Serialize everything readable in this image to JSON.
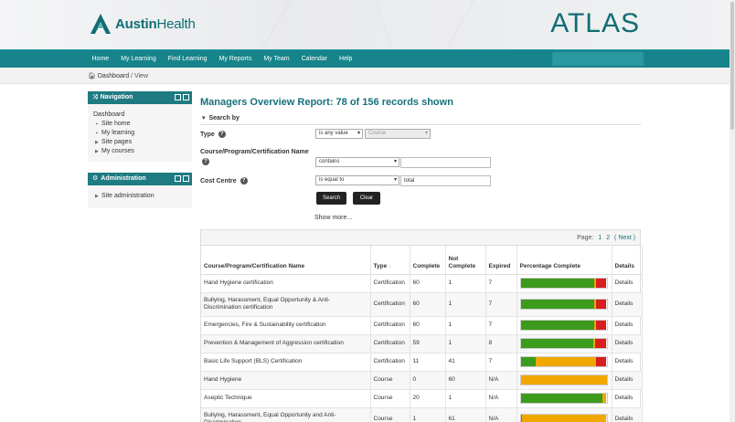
{
  "brand": {
    "logo_bold": "Austin",
    "logo_light": "Health",
    "app_name": "ATLAS"
  },
  "nav": [
    "Home",
    "My Learning",
    "Find Learning",
    "My Reports",
    "My Team",
    "Calendar",
    "Help"
  ],
  "breadcrumb": {
    "home": "Dashboard",
    "sep": "/",
    "current": "View"
  },
  "nav_block": {
    "title": "Navigation",
    "root": "Dashboard",
    "items": [
      "Site home",
      "My learning",
      "Site pages",
      "My courses"
    ]
  },
  "admin_block": {
    "title": "Administration",
    "items": [
      "Site administration"
    ]
  },
  "report": {
    "title": "Managers Overview Report: 78 of 156 records shown",
    "search_by": "Search by",
    "type_label": "Type",
    "type_op": "is any value",
    "type_value": "Course",
    "name_label": "Course/Program/Certification Name",
    "name_op": "contains",
    "name_value": "",
    "cc_label": "Cost Centre",
    "cc_op": "is equal to",
    "cc_value": "total",
    "search_btn": "Search",
    "clear_btn": "Clear",
    "show_more": "Show more..."
  },
  "pager": {
    "label": "Page:",
    "pages": [
      "1",
      "2"
    ],
    "next": "( Next )"
  },
  "table": {
    "headers": [
      "Course/Program/Certification Name",
      "Type",
      "Complete",
      "Not Complete",
      "Expired",
      "Percentage Complete",
      "Details"
    ],
    "rows": [
      {
        "name": "Hand Hygiene certification",
        "type": "Certification",
        "complete": "60",
        "not_complete": "1",
        "expired": "7",
        "pct": {
          "complete": 86,
          "not_complete": 2,
          "expired": 12
        },
        "details": "Details",
        "tall": false
      },
      {
        "name": "Bullying, Harassment, Equal Opportunity & Anti-Discrimination certification",
        "type": "Certification",
        "complete": "60",
        "not_complete": "1",
        "expired": "7",
        "pct": {
          "complete": 86,
          "not_complete": 2,
          "expired": 12
        },
        "details": "Details",
        "tall": true
      },
      {
        "name": "Emergencies, Fire & Sustainability certification",
        "type": "Certification",
        "complete": "60",
        "not_complete": "1",
        "expired": "7",
        "pct": {
          "complete": 86,
          "not_complete": 2,
          "expired": 12
        },
        "details": "Details",
        "tall": false
      },
      {
        "name": "Prevention & Management of Aggression certification",
        "type": "Certification",
        "complete": "59",
        "not_complete": "1",
        "expired": "8",
        "pct": {
          "complete": 85,
          "not_complete": 2,
          "expired": 13
        },
        "details": "Details",
        "tall": false
      },
      {
        "name": "Basic Life Support (BLS) Certification",
        "type": "Certification",
        "complete": "11",
        "not_complete": "41",
        "expired": "7",
        "pct": {
          "complete": 18,
          "not_complete": 70,
          "expired": 12
        },
        "details": "Details",
        "tall": false
      },
      {
        "name": "Hand Hygiene",
        "type": "Course",
        "complete": "0",
        "not_complete": "60",
        "expired": "N/A",
        "pct": {
          "complete": 0,
          "not_complete": 100,
          "expired": 0
        },
        "details": "Details",
        "tall": false
      },
      {
        "name": "Aseptic Technique",
        "type": "Course",
        "complete": "20",
        "not_complete": "1",
        "expired": "N/A",
        "pct": {
          "complete": 95,
          "not_complete": 5,
          "expired": 0
        },
        "details": "Details",
        "tall": false
      },
      {
        "name": "Bullying, Harassment, Equal Opportunity and Anti-Discrimination",
        "type": "Course",
        "complete": "1",
        "not_complete": "61",
        "expired": "N/A",
        "pct": {
          "complete": 2,
          "not_complete": 98,
          "expired": 0
        },
        "details": "Details",
        "tall": true
      }
    ]
  },
  "colors": {
    "teal": "#16848a",
    "complete": "#3c9a1c",
    "not_complete": "#f0a800",
    "expired": "#d81e1e"
  }
}
